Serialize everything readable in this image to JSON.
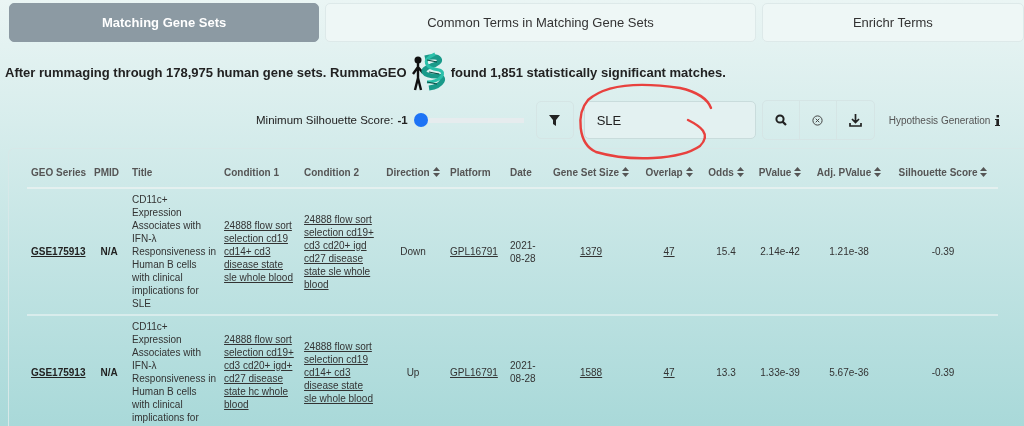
{
  "tabs": [
    {
      "label": "Matching Gene Sets",
      "selected": true
    },
    {
      "label": "Common Terms in Matching Gene Sets",
      "selected": false
    },
    {
      "label": "Enrichr Terms",
      "selected": false
    }
  ],
  "headline": {
    "before": "After rummaging through 178,975 human gene sets. RummaGEO",
    "after": "found 1,851 statistically significant matches."
  },
  "silhouette_filter": {
    "label": "Minimum Silhouette Score:",
    "value": "-1",
    "level": 0
  },
  "search": {
    "value": "SLE"
  },
  "hypothesis": {
    "label": "Hypothesis Generation"
  },
  "table": {
    "columns": [
      {
        "label": "GEO Series",
        "sortable": false,
        "kind": "bold-link"
      },
      {
        "label": "PMID",
        "sortable": false,
        "kind": "bold"
      },
      {
        "label": "Title",
        "sortable": false,
        "kind": "text"
      },
      {
        "label": "Condition 1",
        "sortable": false,
        "kind": "link"
      },
      {
        "label": "Condition 2",
        "sortable": false,
        "kind": "link"
      },
      {
        "label": "Direction",
        "sortable": true,
        "kind": "center"
      },
      {
        "label": "Platform",
        "sortable": false,
        "kind": "link"
      },
      {
        "label": "Date",
        "sortable": false,
        "kind": "text"
      },
      {
        "label": "Gene Set Size",
        "sortable": true,
        "kind": "link"
      },
      {
        "label": "Overlap",
        "sortable": true,
        "kind": "link"
      },
      {
        "label": "Odds",
        "sortable": true,
        "kind": "center"
      },
      {
        "label": "PValue",
        "sortable": true,
        "kind": "center"
      },
      {
        "label": "Adj. PValue",
        "sortable": true,
        "kind": "center"
      },
      {
        "label": "Silhouette Score",
        "sortable": true,
        "kind": "center"
      }
    ],
    "rows": [
      [
        "GSE175913",
        "N/A",
        "CD11c+ Expression Associates with IFN-λ Responsiveness in Human B cells with clinical implications for SLE",
        "24888 flow sort selection cd19 cd14+ cd3 disease state sle whole blood",
        "24888 flow sort selection cd19+ cd3 cd20+ igd cd27 disease state sle whole blood",
        "Down",
        "GPL16791",
        "2021-08-28",
        "1379",
        "47",
        "15.4",
        "2.14e-42",
        "1.21e-38",
        "-0.39"
      ],
      [
        "GSE175913",
        "N/A",
        "CD11c+ Expression Associates with IFN-λ Responsiveness in Human B cells with clinical implications for",
        "24888 flow sort selection cd19+ cd3 cd20+ igd+ cd27 disease state hc whole blood",
        "24888 flow sort selection cd19 cd14+ cd3 disease state sle whole blood",
        "Up",
        "GPL16791",
        "2021-08-28",
        "1588",
        "47",
        "13.3",
        "1.33e-39",
        "5.67e-36",
        "-0.39"
      ]
    ]
  }
}
